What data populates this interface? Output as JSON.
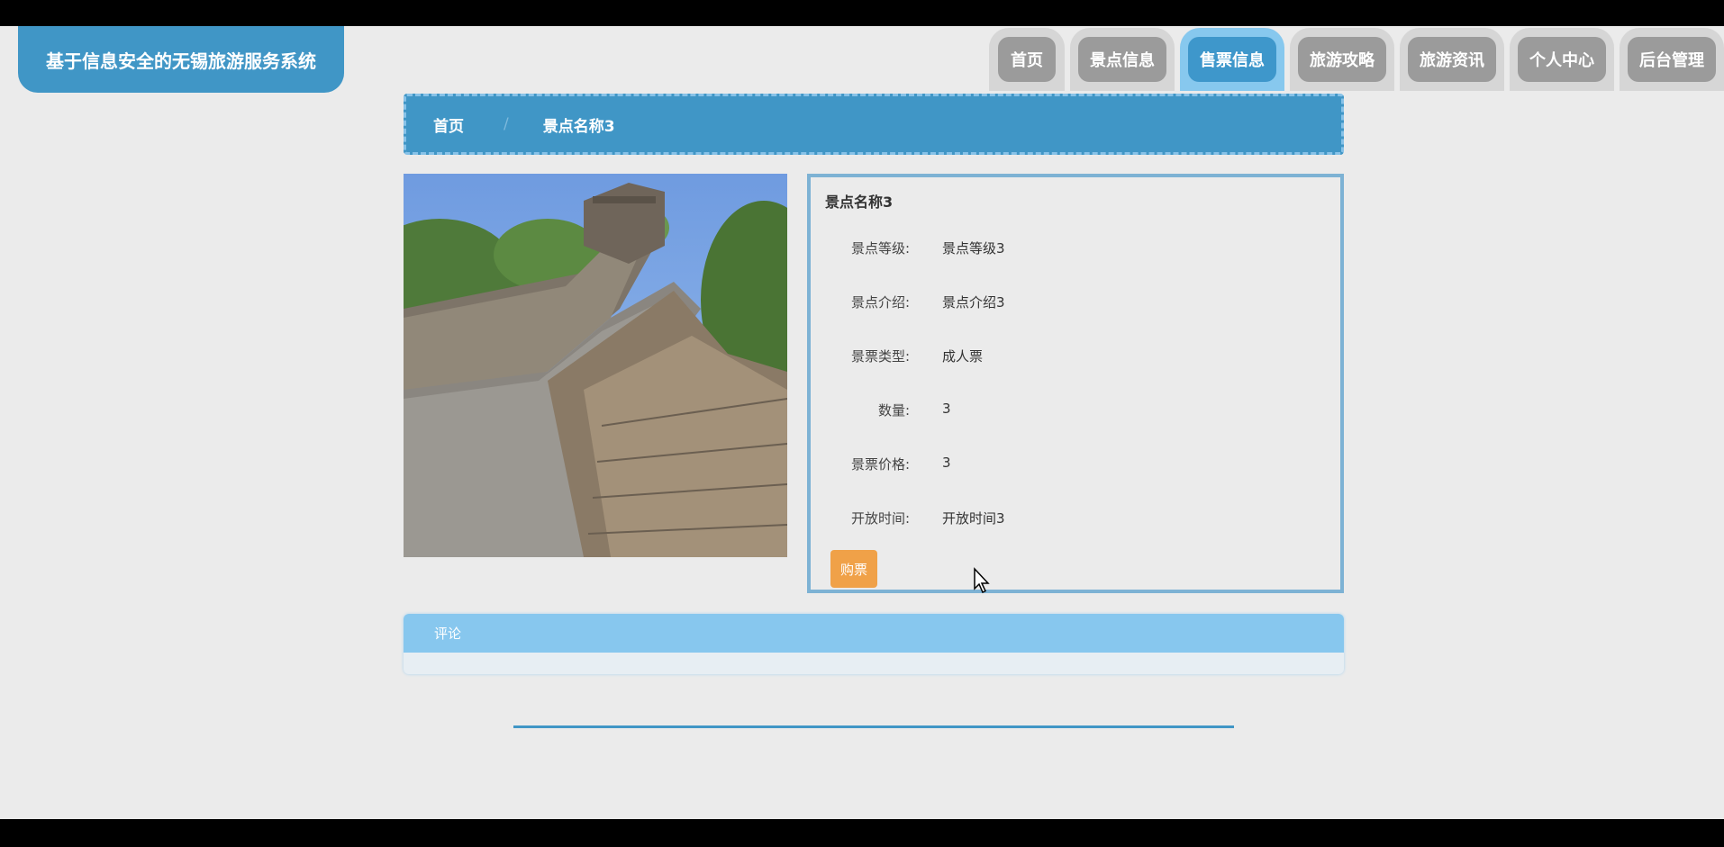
{
  "app": {
    "title": "基于信息安全的无锡旅游服务系统"
  },
  "nav": {
    "items": [
      {
        "label": "首页",
        "active": false
      },
      {
        "label": "景点信息",
        "active": false
      },
      {
        "label": "售票信息",
        "active": true
      },
      {
        "label": "旅游攻略",
        "active": false
      },
      {
        "label": "旅游资讯",
        "active": false
      },
      {
        "label": "个人中心",
        "active": false
      },
      {
        "label": "后台管理",
        "active": false
      }
    ]
  },
  "breadcrumb": {
    "home": "首页",
    "separator": "/",
    "current": "景点名称3"
  },
  "detail": {
    "title": "景点名称3",
    "fields": [
      {
        "label": "景点等级:",
        "value": "景点等级3"
      },
      {
        "label": "景点介绍:",
        "value": "景点介绍3"
      },
      {
        "label": "景票类型:",
        "value": "成人票"
      },
      {
        "label": "数量:",
        "value": "3"
      },
      {
        "label": "景票价格:",
        "value": "3"
      },
      {
        "label": "开放时间:",
        "value": "开放时间3"
      }
    ],
    "buy_label": "购票"
  },
  "comments": {
    "header": "评论"
  },
  "colors": {
    "primary": "#4096c6",
    "accent": "#f0a148",
    "light_blue": "#87c7ee"
  }
}
